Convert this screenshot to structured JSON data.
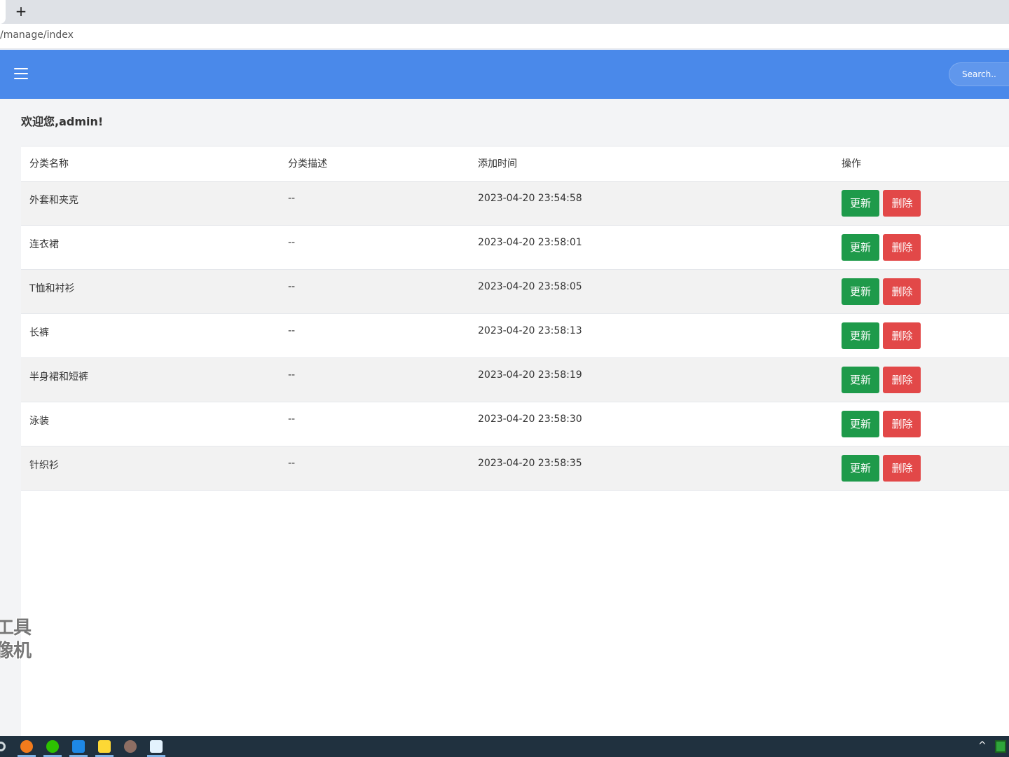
{
  "browser": {
    "new_tab_symbol": "+",
    "address": "/manage/index"
  },
  "header": {
    "menu_icon": "hamburger-menu-icon",
    "search_placeholder": "Search.."
  },
  "main": {
    "welcome": "欢迎您,admin!",
    "table": {
      "headers": [
        "分类名称",
        "分类描述",
        "添加时间",
        "操作"
      ],
      "rows": [
        {
          "name": "外套和夹克",
          "desc": "--",
          "time": "2023-04-20 23:54:58"
        },
        {
          "name": "连衣裙",
          "desc": "--",
          "time": "2023-04-20 23:58:01"
        },
        {
          "name": "T恤和衬衫",
          "desc": "--",
          "time": "2023-04-20 23:58:05"
        },
        {
          "name": "长裤",
          "desc": "--",
          "time": "2023-04-20 23:58:13"
        },
        {
          "name": "半身裙和短裤",
          "desc": "--",
          "time": "2023-04-20 23:58:19"
        },
        {
          "name": "泳装",
          "desc": "--",
          "time": "2023-04-20 23:58:30"
        },
        {
          "name": "针织衫",
          "desc": "--",
          "time": "2023-04-20 23:58:35"
        }
      ],
      "update_label": "更新",
      "delete_label": "删除"
    }
  },
  "watermark": {
    "line1": "工具",
    "line2": "像机"
  },
  "colors": {
    "header_bg": "#4a89ea",
    "update_btn": "#1e9a4a",
    "delete_btn": "#e24848",
    "taskbar_bg": "#20313f"
  },
  "taskbar": {
    "icons": [
      "settings-icon",
      "browser-icon",
      "wechat-icon",
      "app-icon",
      "notes-icon",
      "avatar-icon",
      "baidu-netdisk-icon"
    ],
    "tray_chevron": "^"
  }
}
